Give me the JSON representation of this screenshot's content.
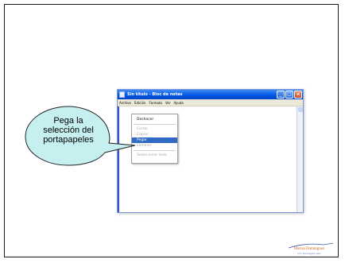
{
  "window": {
    "title": "Sin título - Bloc de notas",
    "controls": {
      "minimize": "_",
      "maximize": "□",
      "close": "✕"
    }
  },
  "menubar": {
    "items": [
      "Archivo",
      "Edición",
      "Formato",
      "Ver",
      "Ayuda"
    ]
  },
  "context_menu": {
    "items": [
      {
        "label": "Deshacer",
        "enabled": true
      },
      {
        "label": "Cortar",
        "enabled": false
      },
      {
        "label": "Copiar",
        "enabled": false
      },
      {
        "label": "Pegar",
        "enabled": true,
        "selected": true
      },
      {
        "label": "Eliminar",
        "enabled": false
      },
      {
        "label": "Seleccionar todo",
        "enabled": false
      }
    ]
  },
  "callout": {
    "lines": [
      "Pega la",
      "selección del",
      "portapapeles"
    ]
  },
  "logo": {
    "text": "Marisa Dominguez",
    "subtext": "Info Tecnologica Labs"
  },
  "colors": {
    "callout_fill": "#c6f0f0",
    "titlebar": "#0054e3",
    "selection": "#316ac5",
    "logo_accent": "#c86a1a"
  }
}
